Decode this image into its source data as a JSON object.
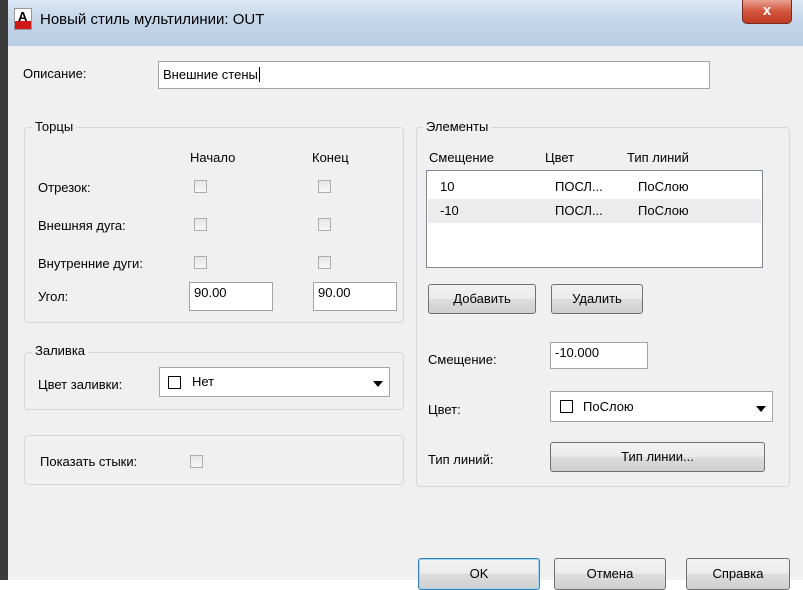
{
  "titlebar": {
    "title": "Новый стиль мультилинии: OUT",
    "icon_letter": "A",
    "close_label": "x"
  },
  "description": {
    "label": "Описание:",
    "value": "Внешние стены"
  },
  "caps": {
    "title": "Торцы",
    "col_start": "Начало",
    "col_end": "Конец",
    "rows": [
      {
        "label": "Отрезок:",
        "start_checked": false,
        "end_checked": false
      },
      {
        "label": "Внешняя дуга:",
        "start_checked": false,
        "end_checked": false
      },
      {
        "label": "Внутренние дуги:",
        "start_checked": false,
        "end_checked": false
      }
    ],
    "angle_label": "Угол:",
    "angle_start": "90.00",
    "angle_end": "90.00"
  },
  "fill": {
    "title": "Заливка",
    "color_label": "Цвет заливки:",
    "color_value": "Нет"
  },
  "joints": {
    "label": "Показать стыки:",
    "checked": false
  },
  "elements": {
    "title": "Элементы",
    "columns": [
      "Смещение",
      "Цвет",
      "Тип линий"
    ],
    "rows": [
      {
        "offset": "10",
        "color": "ПОСЛ...",
        "linetype": "ПоСлою"
      },
      {
        "offset": "-10",
        "color": "ПОСЛ...",
        "linetype": "ПоСлою"
      }
    ],
    "add_button": "Добавить",
    "delete_button": "Удалить",
    "offset_label": "Смещение:",
    "offset_value": "-10.000",
    "color_label": "Цвет:",
    "color_value": "ПоСлою",
    "linetype_label": "Тип линий:",
    "linetype_button": "Тип линии..."
  },
  "footer": {
    "ok": "OK",
    "cancel": "Отмена",
    "help": "Справка"
  }
}
